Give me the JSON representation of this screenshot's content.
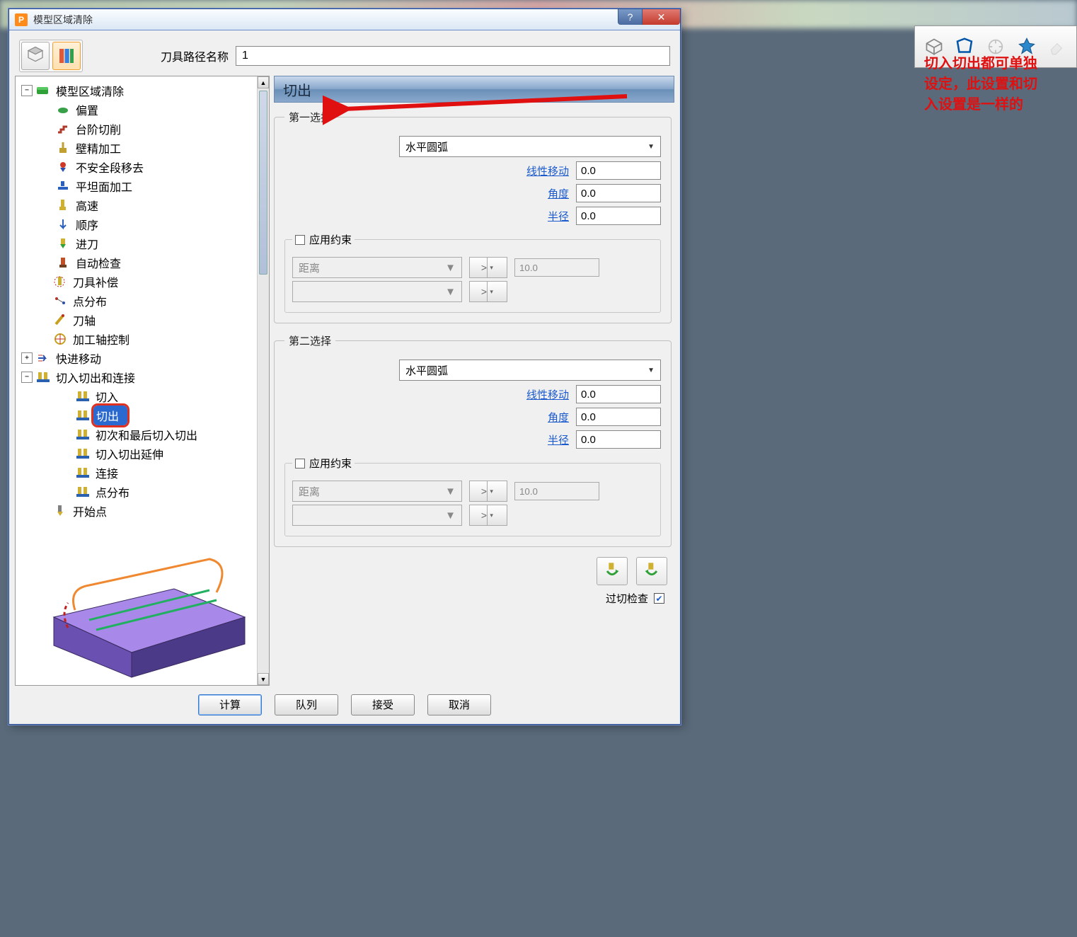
{
  "window": {
    "title": "模型区域清除",
    "help_btn": "?",
    "close_btn": "✕"
  },
  "top": {
    "name_label": "刀具路径名称",
    "name_value": "1"
  },
  "tree": {
    "root": "模型区域清除",
    "n_offset": "偏置",
    "n_step": "台阶切削",
    "n_wall": "壁精加工",
    "n_unsafe": "不安全段移去",
    "n_flat": "平坦面加工",
    "n_highspeed": "高速",
    "n_order": "顺序",
    "n_plunge": "进刀",
    "n_auto": "自动检查",
    "n_toolcomp": "刀具补偿",
    "n_ptdist": "点分布",
    "n_axis": "刀轴",
    "n_axisctrl": "加工轴控制",
    "n_fastmove": "快进移动",
    "n_leads": "切入切出和连接",
    "n_leadin": "切入",
    "n_leadout": "切出",
    "n_firstlast": "初次和最后切入切出",
    "n_leadext": "切入切出延伸",
    "n_link": "连接",
    "n_ptdist2": "点分布",
    "n_startpt": "开始点"
  },
  "panel": {
    "title": "切出",
    "group1_label": "第一选择",
    "group2_label": "第二选择",
    "dd_value": "水平圆弧",
    "lbl_linear": "线性移动",
    "lbl_angle": "角度",
    "lbl_radius": "半径",
    "val_linear": "0.0",
    "val_angle": "0.0",
    "val_radius": "0.0",
    "apply_constraint": "应用约束",
    "dist_label": "距离",
    "dist_value": "10.0",
    "gouge_check": "过切检查"
  },
  "buttons": {
    "calc": "计算",
    "queue": "队列",
    "accept": "接受",
    "cancel": "取消"
  },
  "annotation": {
    "line1": "切入切出都可单独",
    "line2": "设定，此设置和切",
    "line3": "入设置是一样的"
  }
}
